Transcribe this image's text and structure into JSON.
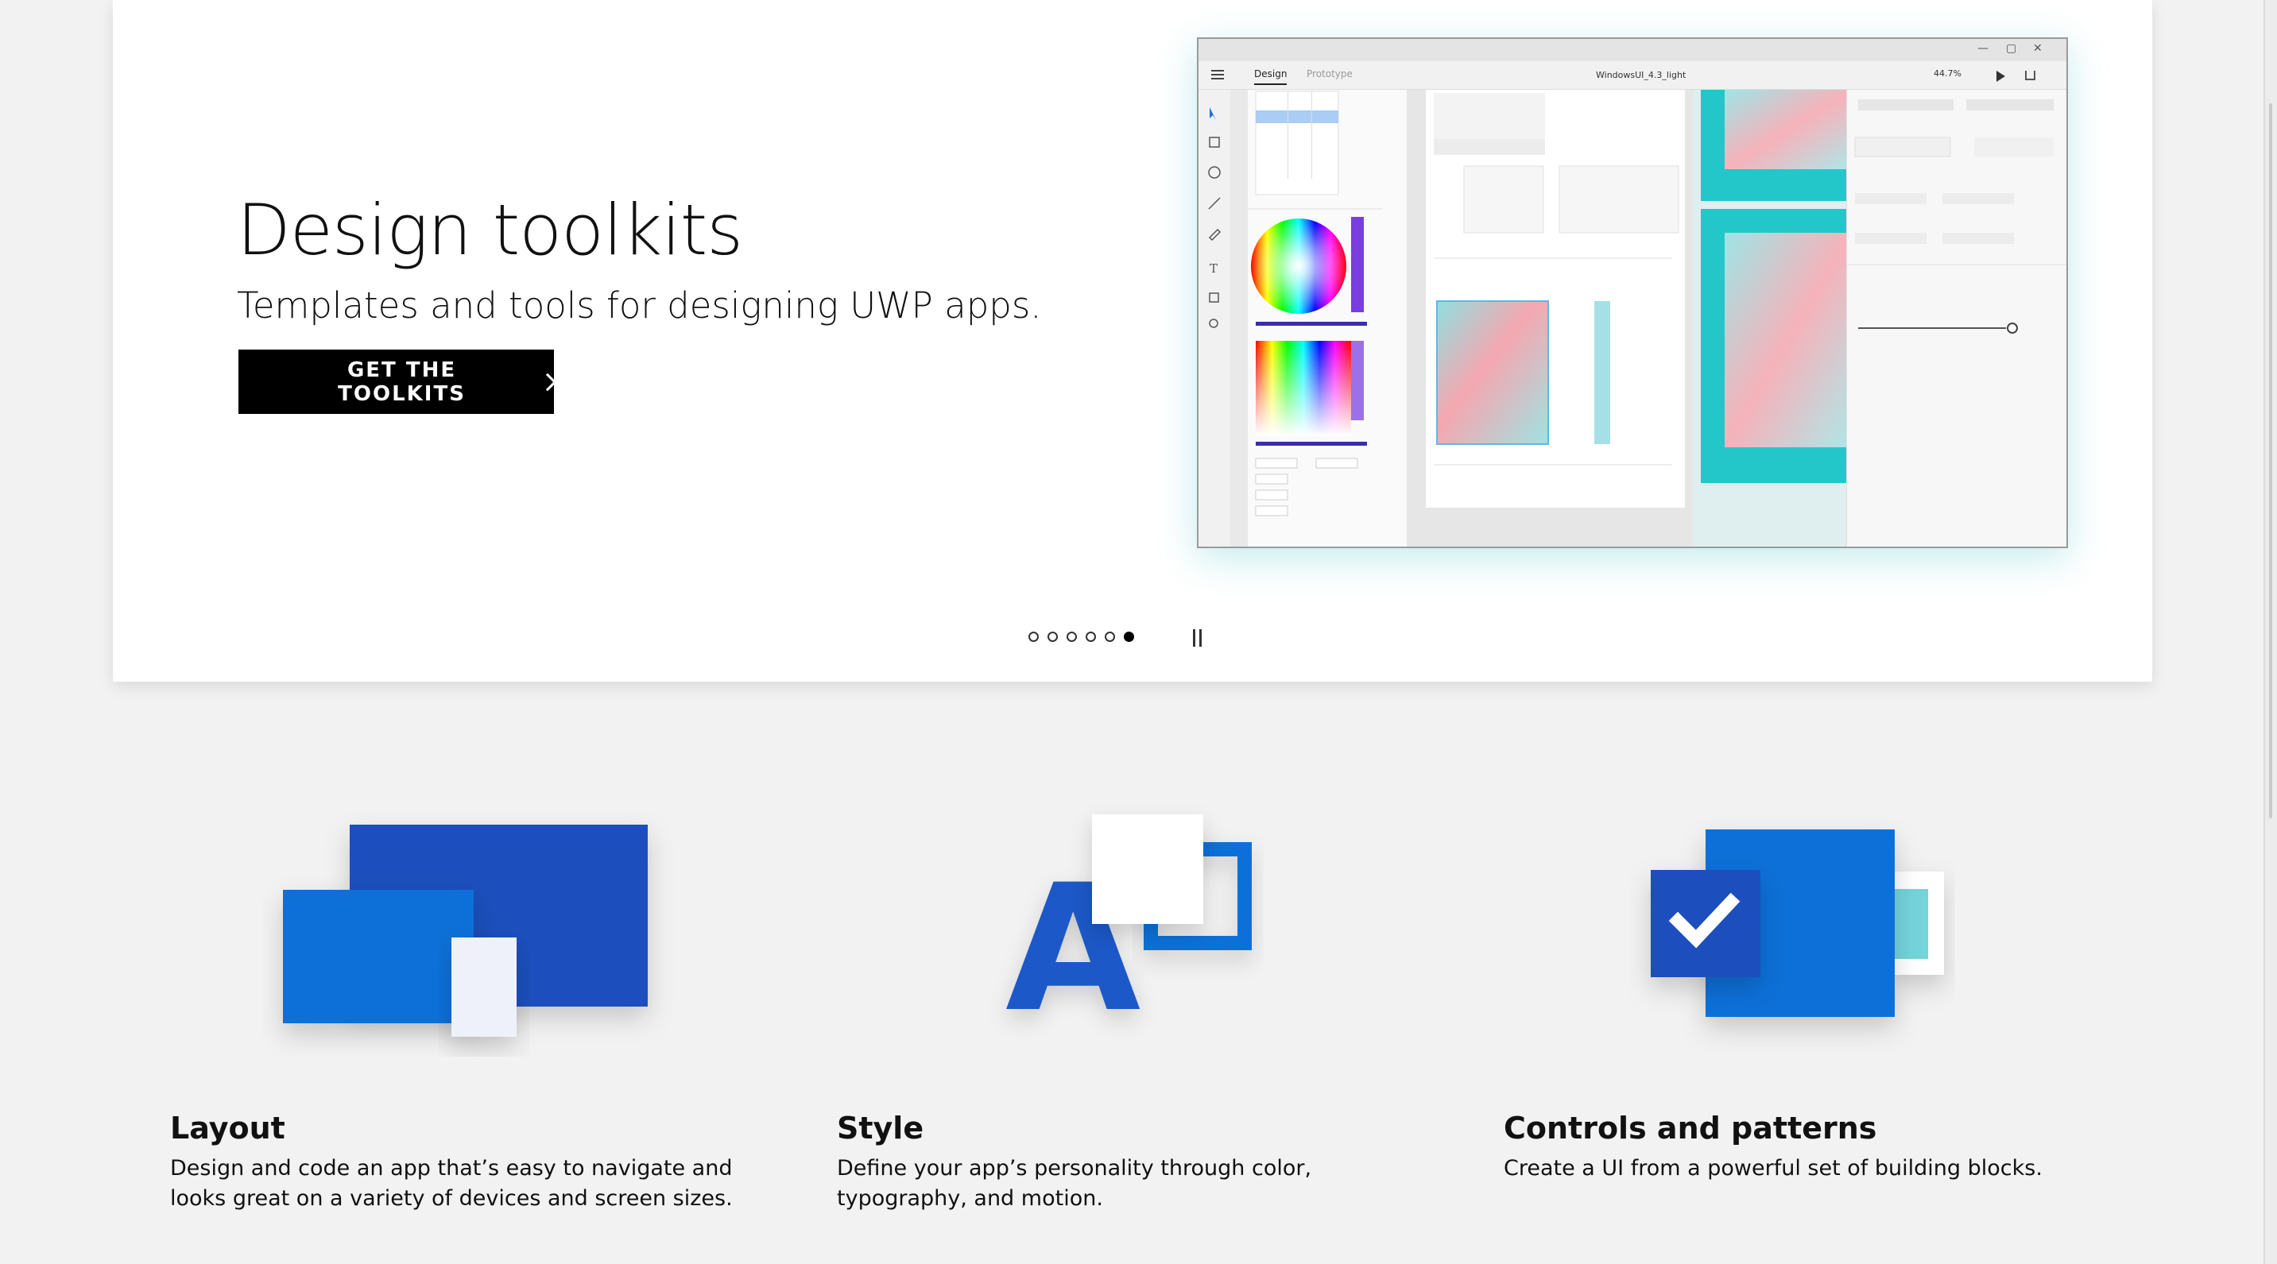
{
  "hero": {
    "title": "Design toolkits",
    "subtitle": "Templates and tools for designing UWP apps.",
    "cta_label": "GET THE TOOLKITS",
    "carousel": {
      "slide_count": 6,
      "active_index": 5
    }
  },
  "mockup": {
    "tabs": [
      "Design",
      "Prototype"
    ],
    "file_name": "WindowsUI_4.3_light",
    "zoom": "44.7%",
    "window_controls": [
      "—",
      "▢",
      "✕"
    ]
  },
  "features": [
    {
      "title": "Layout",
      "description_lines": [
        "Design and code an app that’s easy to navigate and",
        "looks great on a variety of devices and screen sizes."
      ]
    },
    {
      "title": "Style",
      "description_lines": [
        "Define your app’s personality through color,",
        "typography, and motion."
      ]
    },
    {
      "title": "Controls and patterns",
      "description_lines": [
        "Create a UI from a powerful set of building blocks."
      ]
    }
  ],
  "colors": {
    "blue_dark": "#1e4fb8",
    "blue_mid": "#0a6fd8",
    "blue_bright": "#0c79e6",
    "teal": "#29c4c4",
    "pink": "#f19aa6",
    "black": "#000000"
  },
  "icons": [
    "menu-icon",
    "play-icon",
    "share-icon",
    "checkmark-icon",
    "pause-icon",
    "chevron-right-icon"
  ]
}
